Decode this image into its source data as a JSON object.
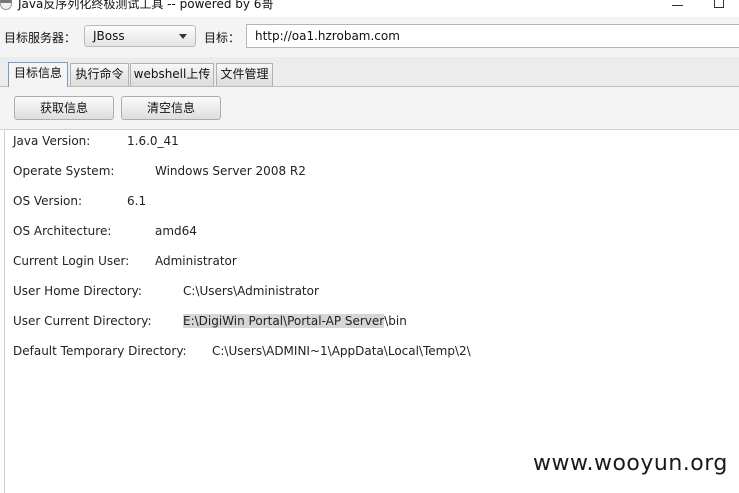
{
  "window": {
    "title": "Java反序列化终极测试工具  -- powered by 6哥",
    "app_icon": "coffee-cup-icon",
    "minimize_icon": "minimize-icon",
    "maximize_icon": "maximize-icon"
  },
  "toolbar": {
    "server_label": "目标服务器：",
    "server_selected": "JBoss",
    "target_label": "目标：",
    "target_value": "http://oa1.hzrobam.com"
  },
  "tabs": [
    {
      "label": "目标信息",
      "active": true
    },
    {
      "label": "执行命令",
      "active": false
    },
    {
      "label": "webshell上传",
      "active": false
    },
    {
      "label": "文件管理",
      "active": false
    }
  ],
  "actions": {
    "fetch_label": "获取信息",
    "clear_label": "清空信息"
  },
  "info": [
    {
      "key": "Java Version:",
      "value": "1.6.0_41"
    },
    {
      "key": "Operate System:",
      "value": "Windows Server 2008 R2"
    },
    {
      "key": "OS Version:",
      "value": "6.1"
    },
    {
      "key": "OS Architecture:",
      "value": "amd64"
    },
    {
      "key": "Current Login User:",
      "value": "Administrator"
    },
    {
      "key": "User Home Directory:",
      "value": "C:\\Users\\Administrator"
    },
    {
      "key": "User Current Directory:",
      "value_selected": "E:\\DigiWin Portal\\Portal-AP Server",
      "value_rest": "\\bin"
    },
    {
      "key": "Default Temporary Directory:",
      "value": "C:\\Users\\ADMINI~1\\AppData\\Local\\Temp\\2\\"
    }
  ],
  "watermark": "www.wooyun.org"
}
